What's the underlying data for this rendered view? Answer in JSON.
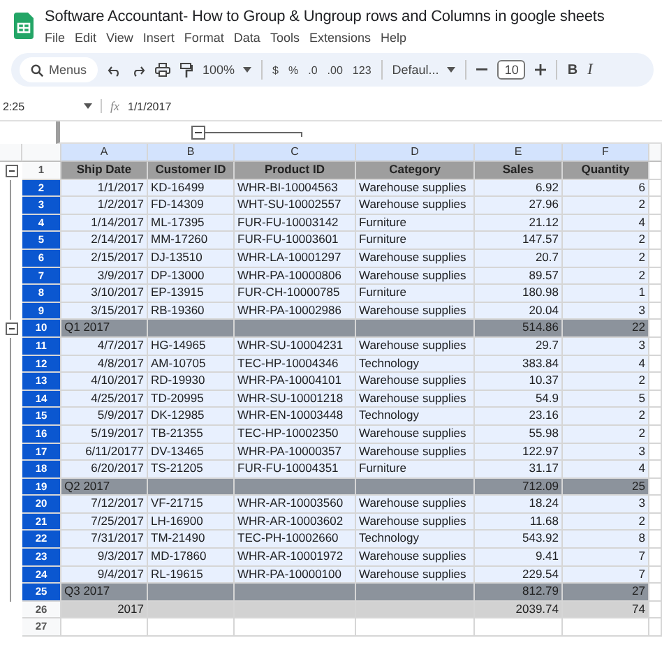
{
  "window": {
    "title": "Software Accountant- How to Group & Ungroup rows and Columns in google sheets"
  },
  "menu": [
    "File",
    "Edit",
    "View",
    "Insert",
    "Format",
    "Data",
    "Tools",
    "Extensions",
    "Help"
  ],
  "toolbar": {
    "search": {
      "placeholder": "Menus"
    },
    "zoom": "100%",
    "format_buttons": [
      "$",
      "%",
      ".0",
      ".00",
      "123"
    ],
    "font": "Defaul...",
    "font_size": "10",
    "style_buttons": [
      "B",
      "I"
    ]
  },
  "formula_bar": {
    "name_box": "2:25",
    "fx": "fx",
    "value": "1/1/2017"
  },
  "column_group": {
    "expanded": true
  },
  "columns": [
    "A",
    "B",
    "C",
    "D",
    "E",
    "F"
  ],
  "rows": [
    {
      "number": "1",
      "kind": "header",
      "selected": false,
      "expanded": true,
      "cells": [
        "Ship Date",
        "Customer ID",
        "Product ID",
        "Category",
        "Sales",
        "Quantity"
      ]
    },
    {
      "number": "2",
      "kind": "data",
      "selected": true,
      "expanded": false,
      "cells": [
        "1/1/2017",
        "KD-16499",
        "WHR-BI-10004563",
        "Warehouse supplies",
        "6.92",
        "6"
      ]
    },
    {
      "number": "3",
      "kind": "data",
      "selected": true,
      "expanded": false,
      "cells": [
        "1/2/2017",
        "FD-14309",
        "WHT-SU-10002557",
        "Warehouse supplies",
        "27.96",
        "2"
      ]
    },
    {
      "number": "4",
      "kind": "data",
      "selected": true,
      "expanded": false,
      "cells": [
        "1/14/2017",
        "ML-17395",
        "FUR-FU-10003142",
        "Furniture",
        "21.12",
        "4"
      ]
    },
    {
      "number": "5",
      "kind": "data",
      "selected": true,
      "expanded": false,
      "cells": [
        "2/14/2017",
        "MM-17260",
        "FUR-FU-10003601",
        "Furniture",
        "147.57",
        "2"
      ]
    },
    {
      "number": "6",
      "kind": "data",
      "selected": true,
      "expanded": false,
      "cells": [
        "2/15/2017",
        "DJ-13510",
        "WHR-LA-10001297",
        "Warehouse supplies",
        "20.7",
        "2"
      ]
    },
    {
      "number": "7",
      "kind": "data",
      "selected": true,
      "expanded": false,
      "cells": [
        "3/9/2017",
        "DP-13000",
        "WHR-PA-10000806",
        "Warehouse supplies",
        "89.57",
        "2"
      ]
    },
    {
      "number": "8",
      "kind": "data",
      "selected": true,
      "expanded": false,
      "cells": [
        "3/10/2017",
        "EP-13915",
        "FUR-CH-10000785",
        "Furniture",
        "180.98",
        "1"
      ]
    },
    {
      "number": "9",
      "kind": "data",
      "selected": true,
      "expanded": false,
      "cells": [
        "3/15/2017",
        "RB-19360",
        "WHR-PA-10002986",
        "Warehouse supplies",
        "20.04",
        "3"
      ]
    },
    {
      "number": "10",
      "kind": "subtotal",
      "selected": true,
      "expanded": true,
      "cells": [
        "Q1 2017",
        "",
        "",
        "",
        "514.86",
        "22"
      ]
    },
    {
      "number": "11",
      "kind": "data",
      "selected": true,
      "expanded": false,
      "cells": [
        "4/7/2017",
        "HG-14965",
        "WHR-SU-10004231",
        "Warehouse supplies",
        "29.7",
        "3"
      ]
    },
    {
      "number": "12",
      "kind": "data",
      "selected": true,
      "expanded": false,
      "cells": [
        "4/8/2017",
        "AM-10705",
        "TEC-HP-10004346",
        "Technology",
        "383.84",
        "4"
      ]
    },
    {
      "number": "13",
      "kind": "data",
      "selected": true,
      "expanded": false,
      "cells": [
        "4/10/2017",
        "RD-19930",
        "WHR-PA-10004101",
        "Warehouse supplies",
        "10.37",
        "2"
      ]
    },
    {
      "number": "14",
      "kind": "data",
      "selected": true,
      "expanded": false,
      "cells": [
        "4/25/2017",
        "TD-20995",
        "WHR-SU-10001218",
        "Warehouse supplies",
        "54.9",
        "5"
      ]
    },
    {
      "number": "15",
      "kind": "data",
      "selected": true,
      "expanded": false,
      "cells": [
        "5/9/2017",
        "DK-12985",
        "WHR-EN-10003448",
        "Technology",
        "23.16",
        "2"
      ]
    },
    {
      "number": "16",
      "kind": "data",
      "selected": true,
      "expanded": false,
      "cells": [
        "5/19/2017",
        "TB-21355",
        "TEC-HP-10002350",
        "Warehouse supplies",
        "55.98",
        "2"
      ]
    },
    {
      "number": "17",
      "kind": "data",
      "selected": true,
      "expanded": false,
      "cells": [
        "6/11/20177",
        "DV-13465",
        "WHR-PA-10000357",
        "Warehouse supplies",
        "122.97",
        "3"
      ]
    },
    {
      "number": "18",
      "kind": "data",
      "selected": true,
      "expanded": false,
      "cells": [
        "6/20/2017",
        "TS-21205",
        "FUR-FU-10004351",
        "Furniture",
        "31.17",
        "4"
      ]
    },
    {
      "number": "19",
      "kind": "subtotal",
      "selected": true,
      "expanded": false,
      "cells": [
        "Q2 2017",
        "",
        "",
        "",
        "712.09",
        "25"
      ]
    },
    {
      "number": "20",
      "kind": "data",
      "selected": true,
      "expanded": false,
      "cells": [
        "7/12/2017",
        "VF-21715",
        "WHR-AR-10003560",
        "Warehouse supplies",
        "18.24",
        "3"
      ]
    },
    {
      "number": "21",
      "kind": "data",
      "selected": true,
      "expanded": false,
      "cells": [
        "7/25/2017",
        "LH-16900",
        "WHR-AR-10003602",
        "Warehouse supplies",
        "11.68",
        "2"
      ]
    },
    {
      "number": "22",
      "kind": "data",
      "selected": true,
      "expanded": false,
      "cells": [
        "7/31/2017",
        "TM-21490",
        "TEC-PH-10002660",
        "Technology",
        "543.92",
        "8"
      ]
    },
    {
      "number": "23",
      "kind": "data",
      "selected": true,
      "expanded": false,
      "cells": [
        "9/3/2017",
        "MD-17860",
        "WHR-AR-10001972",
        "Warehouse supplies",
        "9.41",
        "7"
      ]
    },
    {
      "number": "24",
      "kind": "data",
      "selected": true,
      "expanded": false,
      "cells": [
        "9/4/2017",
        "RL-19615",
        "WHR-PA-10000100",
        "Warehouse supplies",
        "229.54",
        "7"
      ]
    },
    {
      "number": "25",
      "kind": "subtotal",
      "selected": true,
      "expanded": false,
      "cells": [
        "Q3 2017",
        "",
        "",
        "",
        "812.79",
        "27"
      ]
    },
    {
      "number": "26",
      "kind": "total",
      "selected": false,
      "expanded": false,
      "cells": [
        "2017",
        "",
        "",
        "",
        "2039.74",
        "74"
      ]
    },
    {
      "number": "27",
      "kind": "blank",
      "selected": false,
      "expanded": false,
      "cells": [
        "",
        "",
        "",
        "",
        "",
        ""
      ]
    }
  ]
}
